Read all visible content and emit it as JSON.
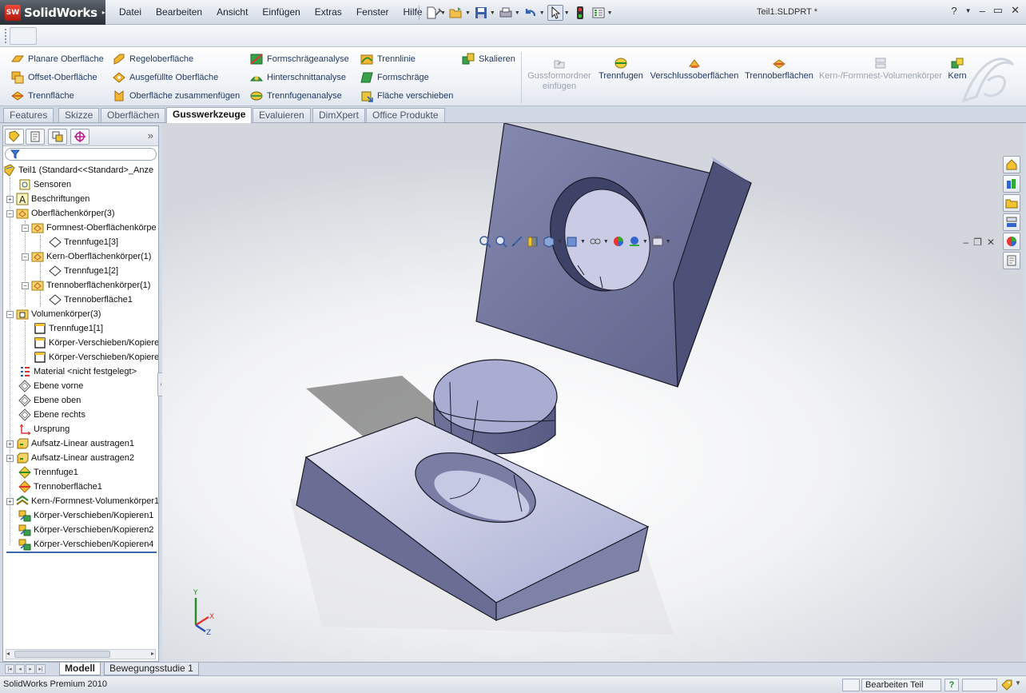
{
  "app": {
    "logo_badge": "SW",
    "logo_text": "SolidWorks",
    "document_title": "Teil1.SLDPRT *",
    "win_help": "?",
    "win_min": "–",
    "win_max": "▭",
    "win_close": "✕"
  },
  "menu": [
    "Datei",
    "Bearbeiten",
    "Ansicht",
    "Einfügen",
    "Extras",
    "Fenster",
    "Hilfe"
  ],
  "command_manager": {
    "col1": [
      "Planare Oberfläche",
      "Offset-Oberfläche",
      "Trennfläche"
    ],
    "col2": [
      "Regeloberfläche",
      "Ausgefüllte Oberfläche",
      "Oberfläche zusammenfügen"
    ],
    "col3": [
      "Formschrägeanalyse",
      "Hinterschnittanalyse",
      "Trennfugenanalyse"
    ],
    "col4": [
      "Trennlinie",
      "Formschräge",
      "Fläche verschieben"
    ],
    "col5": [
      "Skalieren"
    ],
    "big": [
      {
        "label": "Gussformordner einfügen",
        "disabled": true
      },
      {
        "label": "Trennfugen",
        "disabled": false
      },
      {
        "label": "Verschlussoberflächen",
        "disabled": false
      },
      {
        "label": "Trennoberflächen",
        "disabled": false
      },
      {
        "label": "Kern-/Formnest-Volumenkörper",
        "disabled": true
      },
      {
        "label": "Kern",
        "disabled": false
      }
    ]
  },
  "tabs": [
    "Features",
    "Skizze",
    "Oberflächen",
    "Gusswerkzeuge",
    "Evaluieren",
    "DimXpert",
    "Office Produkte"
  ],
  "active_tab": "Gusswerkzeuge",
  "tree": [
    {
      "label": "Teil1  (Standard<<Standard>_Anze",
      "icon": "part-icon"
    },
    {
      "label": "Sensoren",
      "icon": "sensor-icon"
    },
    {
      "label": "Beschriftungen",
      "icon": "annotation-icon"
    },
    {
      "label": "Oberflächenkörper(3)",
      "icon": "surface-folder-icon"
    },
    {
      "label": "Formnest-Oberflächenkörpe",
      "icon": "surface-folder-icon"
    },
    {
      "label": "Trennfuge1[3]",
      "icon": "surface-body-icon"
    },
    {
      "label": "Kern-Oberflächenkörper(1)",
      "icon": "surface-folder-icon"
    },
    {
      "label": "Trennfuge1[2]",
      "icon": "surface-body-icon"
    },
    {
      "label": "Trennoberflächenkörper(1)",
      "icon": "surface-folder-icon"
    },
    {
      "label": "Trennoberfläche1",
      "icon": "surface-body-icon"
    },
    {
      "label": "Volumenkörper(3)",
      "icon": "solid-folder-icon"
    },
    {
      "label": "Trennfuge1[1]",
      "icon": "solid-body-icon"
    },
    {
      "label": "Körper-Verschieben/Kopiere",
      "icon": "solid-body-icon"
    },
    {
      "label": "Körper-Verschieben/Kopiere",
      "icon": "solid-body-icon"
    },
    {
      "label": "Material <nicht festgelegt>",
      "icon": "material-icon"
    },
    {
      "label": "Ebene vorne",
      "icon": "plane-icon"
    },
    {
      "label": "Ebene oben",
      "icon": "plane-icon"
    },
    {
      "label": "Ebene rechts",
      "icon": "plane-icon"
    },
    {
      "label": "Ursprung",
      "icon": "origin-icon"
    },
    {
      "label": "Aufsatz-Linear austragen1",
      "icon": "extrude-icon"
    },
    {
      "label": "Aufsatz-Linear austragen2",
      "icon": "extrude-icon"
    },
    {
      "label": "Trennfuge1",
      "icon": "parting-line-icon"
    },
    {
      "label": "Trennoberfläche1",
      "icon": "parting-surface-icon"
    },
    {
      "label": "Kern-/Formnest-Volumenkörper1",
      "icon": "tooling-split-icon"
    },
    {
      "label": "Körper-Verschieben/Kopieren1",
      "icon": "move-body-icon"
    },
    {
      "label": "Körper-Verschieben/Kopieren2",
      "icon": "move-body-icon"
    },
    {
      "label": "Körper-Verschieben/Kopieren4",
      "icon": "move-body-icon"
    }
  ],
  "bottom_tabs": [
    "Modell",
    "Bewegungsstudie 1"
  ],
  "status": {
    "text": "SolidWorks Premium 2010",
    "mode": "Bearbeiten Teil",
    "help": "?"
  },
  "triad": {
    "x": "X",
    "y": "Y",
    "z": "Z"
  },
  "colors": {
    "model_face": "#7d82a6",
    "model_top": "#aeb2d6",
    "accent": "#2a63b5"
  }
}
